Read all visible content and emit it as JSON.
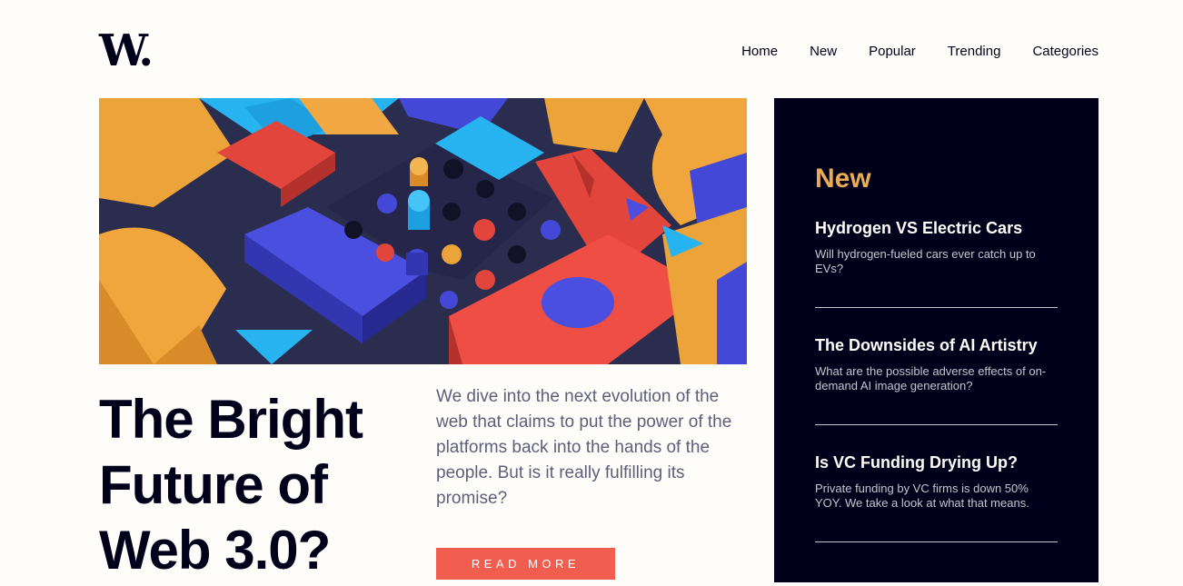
{
  "header": {
    "logo": "W.",
    "nav": [
      "Home",
      "New",
      "Popular",
      "Trending",
      "Categories"
    ]
  },
  "hero": {
    "image_alt": "colorful 3D geometric blocks",
    "title": "The Bright Future of Web 3.0?",
    "description": "We dive into the next evolution of the web that claims to put the power of the platforms back into the hands of the people. But is it really fulfilling its promise?",
    "cta": "READ MORE"
  },
  "sidebar": {
    "heading": "New",
    "items": [
      {
        "title": "Hydrogen VS Electric Cars",
        "text": "Will hydrogen-fueled cars ever catch up to EVs?"
      },
      {
        "title": "The Downsides of AI Artistry",
        "text": "What are the possible adverse effects of on-demand AI image generation?"
      },
      {
        "title": "Is VC Funding Drying Up?",
        "text": "Private funding by VC firms is down 50% YOY. We take a look at what that means."
      }
    ]
  },
  "colors": {
    "dark_navy": "#00001a",
    "soft_orange": "#e9ab53",
    "soft_red": "#f15e50",
    "grayish_blue": "#5d5f79",
    "off_white": "#fffdfa"
  }
}
